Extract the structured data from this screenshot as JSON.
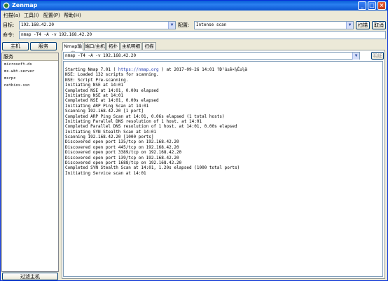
{
  "window": {
    "title": "Zenmap"
  },
  "menu": [
    "扫描(a)",
    "工具(I)",
    "配置(P)",
    "帮助(H)"
  ],
  "target": {
    "label": "目标:",
    "value": "192.168.42.20"
  },
  "profile": {
    "label": "配置:",
    "value": "Intense scan"
  },
  "buttons": {
    "scan": "扫描",
    "cancel": "取消",
    "hosts": "主机",
    "services": "服务",
    "filter": "过滤主机",
    "details": "明细"
  },
  "command": {
    "label": "命令:",
    "value": "nmap -T4 -A -v 192.168.42.20"
  },
  "sidebar": {
    "header": "服务",
    "items": [
      "microsoft-ds",
      "ms-wbt-server",
      "msrpc",
      "netbios-ssn"
    ]
  },
  "tabs": [
    "Nmap输出",
    "端口/主机",
    "拓扑",
    "主机明细",
    "扫描"
  ],
  "output_select": "nmap -T4 -A -v 192.168.42.20",
  "output": {
    "first_line": {
      "pre": "Starting Nmap 7.01 ( ",
      "link": "https://nmap.org",
      "post": " ) at 2017-09-26 14:01 ?Ð¹ú±ê×¼Ê±¼ä"
    },
    "lines": [
      "NSE: Loaded 132 scripts for scanning.",
      "NSE: Script Pre-scanning.",
      "Initiating NSE at 14:01",
      "Completed NSE at 14:01, 0.00s elapsed",
      "Initiating NSE at 14:01",
      "Completed NSE at 14:01, 0.00s elapsed",
      "Initiating ARP Ping Scan at 14:01",
      "Scanning 192.168.42.20 [1 port]",
      "Completed ARP Ping Scan at 14:01, 0.06s elapsed (1 total hosts)",
      "Initiating Parallel DNS resolution of 1 host. at 14:01",
      "Completed Parallel DNS resolution of 1 host. at 14:01, 0.00s elapsed",
      "Initiating SYN Stealth Scan at 14:01",
      "Scanning 192.168.42.20 [1000 ports]",
      "Discovered open port 135/tcp on 192.168.42.20",
      "Discovered open port 445/tcp on 192.168.42.20",
      "Discovered open port 3389/tcp on 192.168.42.20",
      "Discovered open port 139/tcp on 192.168.42.20",
      "Discovered open port 1688/tcp on 192.168.42.20",
      "Completed SYN Stealth Scan at 14:01, 1.20s elapsed (1000 total ports)",
      "Initiating Service scan at 14:01"
    ]
  }
}
